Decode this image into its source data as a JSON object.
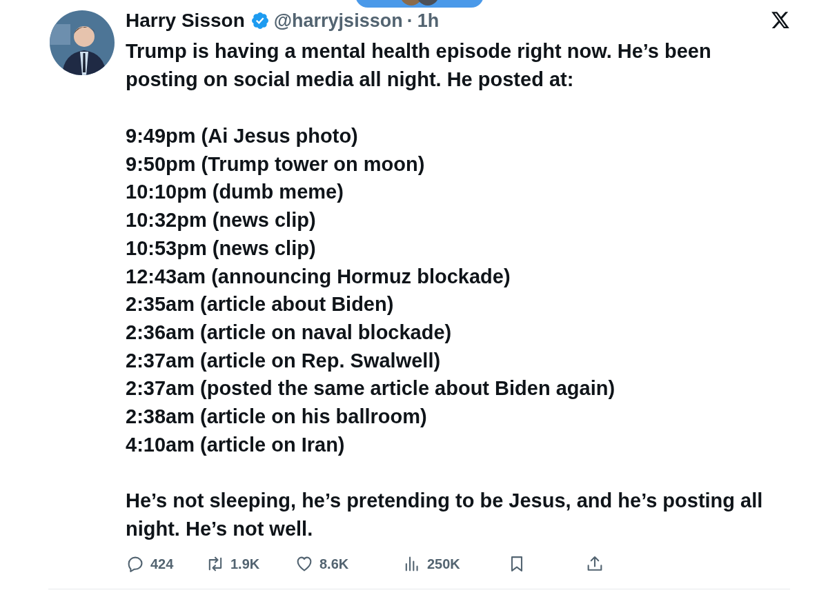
{
  "post": {
    "author": "Harry Sisson",
    "verified": true,
    "handle": "@harryjsisson",
    "separator": "·",
    "time": "1h",
    "intro": "Trump is having a mental health episode right now. He’s been posting on social media all night. He posted at:",
    "timeline": [
      "9:49pm (Ai Jesus photo)",
      "9:50pm (Trump tower on moon)",
      "10:10pm (dumb meme)",
      "10:32pm (news clip)",
      "10:53pm (news clip)",
      "12:43am (announcing Hormuz blockade)",
      "2:35am (article about Biden)",
      "2:36am (article on naval blockade)",
      "2:37am (article on Rep. Swalwell)",
      "2:37am (posted the same article about Biden again)",
      "2:38am (article on his ballroom)",
      "4:10am (article on Iran)"
    ],
    "closing": "He’s not sleeping, he’s pretending to be Jesus, and he’s posting all night. He’s not well.",
    "actions": [
      {
        "kind": "reply",
        "count": "424"
      },
      {
        "kind": "repost",
        "count": "1.9K"
      },
      {
        "kind": "like",
        "count": "8.6K"
      },
      {
        "kind": "views",
        "count": "250K"
      },
      {
        "kind": "bookmark"
      },
      {
        "kind": "share"
      }
    ]
  }
}
